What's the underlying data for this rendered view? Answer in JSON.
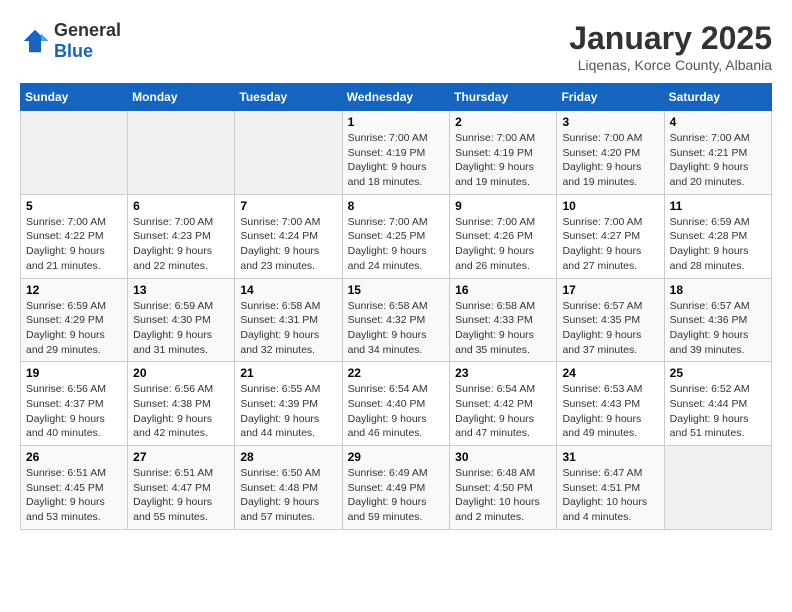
{
  "logo": {
    "general": "General",
    "blue": "Blue"
  },
  "header": {
    "month": "January 2025",
    "location": "Liqenas, Korce County, Albania"
  },
  "weekdays": [
    "Sunday",
    "Monday",
    "Tuesday",
    "Wednesday",
    "Thursday",
    "Friday",
    "Saturday"
  ],
  "weeks": [
    [
      {
        "day": "",
        "sunrise": "",
        "sunset": "",
        "daylight": ""
      },
      {
        "day": "",
        "sunrise": "",
        "sunset": "",
        "daylight": ""
      },
      {
        "day": "",
        "sunrise": "",
        "sunset": "",
        "daylight": ""
      },
      {
        "day": "1",
        "sunrise": "7:00 AM",
        "sunset": "4:19 PM",
        "daylight": "9 hours and 18 minutes."
      },
      {
        "day": "2",
        "sunrise": "7:00 AM",
        "sunset": "4:19 PM",
        "daylight": "9 hours and 19 minutes."
      },
      {
        "day": "3",
        "sunrise": "7:00 AM",
        "sunset": "4:20 PM",
        "daylight": "9 hours and 19 minutes."
      },
      {
        "day": "4",
        "sunrise": "7:00 AM",
        "sunset": "4:21 PM",
        "daylight": "9 hours and 20 minutes."
      }
    ],
    [
      {
        "day": "5",
        "sunrise": "7:00 AM",
        "sunset": "4:22 PM",
        "daylight": "9 hours and 21 minutes."
      },
      {
        "day": "6",
        "sunrise": "7:00 AM",
        "sunset": "4:23 PM",
        "daylight": "9 hours and 22 minutes."
      },
      {
        "day": "7",
        "sunrise": "7:00 AM",
        "sunset": "4:24 PM",
        "daylight": "9 hours and 23 minutes."
      },
      {
        "day": "8",
        "sunrise": "7:00 AM",
        "sunset": "4:25 PM",
        "daylight": "9 hours and 24 minutes."
      },
      {
        "day": "9",
        "sunrise": "7:00 AM",
        "sunset": "4:26 PM",
        "daylight": "9 hours and 26 minutes."
      },
      {
        "day": "10",
        "sunrise": "7:00 AM",
        "sunset": "4:27 PM",
        "daylight": "9 hours and 27 minutes."
      },
      {
        "day": "11",
        "sunrise": "6:59 AM",
        "sunset": "4:28 PM",
        "daylight": "9 hours and 28 minutes."
      }
    ],
    [
      {
        "day": "12",
        "sunrise": "6:59 AM",
        "sunset": "4:29 PM",
        "daylight": "9 hours and 29 minutes."
      },
      {
        "day": "13",
        "sunrise": "6:59 AM",
        "sunset": "4:30 PM",
        "daylight": "9 hours and 31 minutes."
      },
      {
        "day": "14",
        "sunrise": "6:58 AM",
        "sunset": "4:31 PM",
        "daylight": "9 hours and 32 minutes."
      },
      {
        "day": "15",
        "sunrise": "6:58 AM",
        "sunset": "4:32 PM",
        "daylight": "9 hours and 34 minutes."
      },
      {
        "day": "16",
        "sunrise": "6:58 AM",
        "sunset": "4:33 PM",
        "daylight": "9 hours and 35 minutes."
      },
      {
        "day": "17",
        "sunrise": "6:57 AM",
        "sunset": "4:35 PM",
        "daylight": "9 hours and 37 minutes."
      },
      {
        "day": "18",
        "sunrise": "6:57 AM",
        "sunset": "4:36 PM",
        "daylight": "9 hours and 39 minutes."
      }
    ],
    [
      {
        "day": "19",
        "sunrise": "6:56 AM",
        "sunset": "4:37 PM",
        "daylight": "9 hours and 40 minutes."
      },
      {
        "day": "20",
        "sunrise": "6:56 AM",
        "sunset": "4:38 PM",
        "daylight": "9 hours and 42 minutes."
      },
      {
        "day": "21",
        "sunrise": "6:55 AM",
        "sunset": "4:39 PM",
        "daylight": "9 hours and 44 minutes."
      },
      {
        "day": "22",
        "sunrise": "6:54 AM",
        "sunset": "4:40 PM",
        "daylight": "9 hours and 46 minutes."
      },
      {
        "day": "23",
        "sunrise": "6:54 AM",
        "sunset": "4:42 PM",
        "daylight": "9 hours and 47 minutes."
      },
      {
        "day": "24",
        "sunrise": "6:53 AM",
        "sunset": "4:43 PM",
        "daylight": "9 hours and 49 minutes."
      },
      {
        "day": "25",
        "sunrise": "6:52 AM",
        "sunset": "4:44 PM",
        "daylight": "9 hours and 51 minutes."
      }
    ],
    [
      {
        "day": "26",
        "sunrise": "6:51 AM",
        "sunset": "4:45 PM",
        "daylight": "9 hours and 53 minutes."
      },
      {
        "day": "27",
        "sunrise": "6:51 AM",
        "sunset": "4:47 PM",
        "daylight": "9 hours and 55 minutes."
      },
      {
        "day": "28",
        "sunrise": "6:50 AM",
        "sunset": "4:48 PM",
        "daylight": "9 hours and 57 minutes."
      },
      {
        "day": "29",
        "sunrise": "6:49 AM",
        "sunset": "4:49 PM",
        "daylight": "9 hours and 59 minutes."
      },
      {
        "day": "30",
        "sunrise": "6:48 AM",
        "sunset": "4:50 PM",
        "daylight": "10 hours and 2 minutes."
      },
      {
        "day": "31",
        "sunrise": "6:47 AM",
        "sunset": "4:51 PM",
        "daylight": "10 hours and 4 minutes."
      },
      {
        "day": "",
        "sunrise": "",
        "sunset": "",
        "daylight": ""
      }
    ]
  ]
}
